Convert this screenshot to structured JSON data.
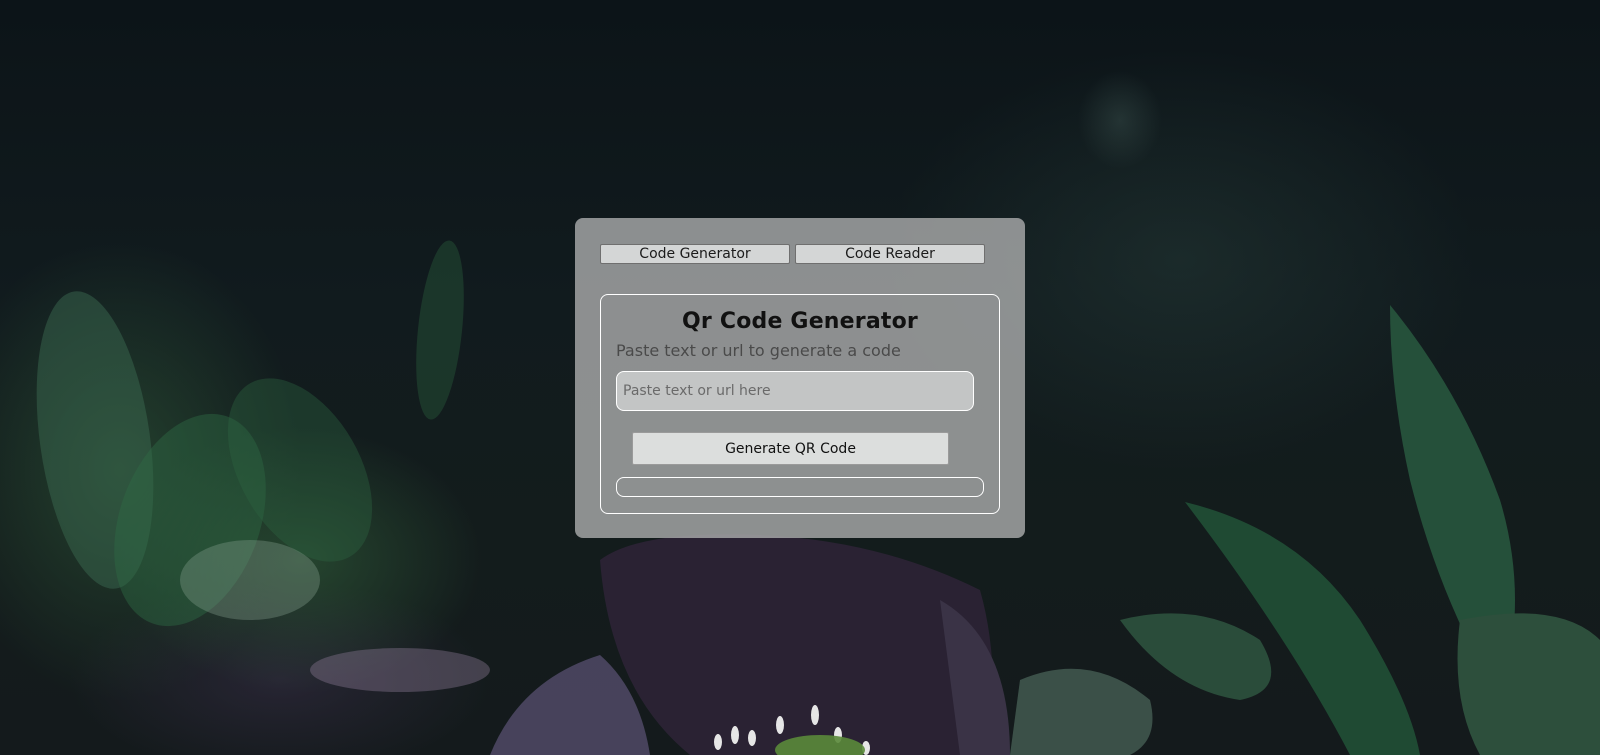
{
  "tabs": {
    "generator_label": "Code Generator",
    "reader_label": "Code Reader"
  },
  "generator": {
    "title": "Qr Code Generator",
    "subtitle": "Paste text or url to generate a code",
    "input_placeholder": "Paste text or url here",
    "input_value": "",
    "button_label": "Generate QR Code"
  },
  "colors": {
    "panel_background": "#a8aaaa",
    "button_background": "#dcdedd",
    "card_border": "#ffffff",
    "page_background": "#0f171a"
  }
}
